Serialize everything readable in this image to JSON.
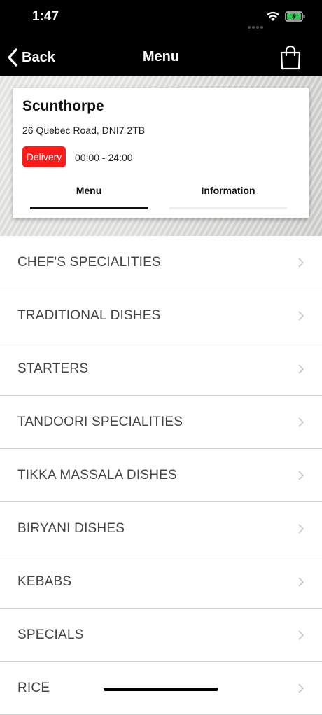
{
  "status_bar": {
    "time": "1:47"
  },
  "nav": {
    "back_label": "Back",
    "title": "Menu"
  },
  "store": {
    "name": "Scunthorpe",
    "address": "26 Quebec Road, DNI7 2TB",
    "delivery_badge": "Delivery",
    "hours": "00:00 - 24:00",
    "badge_color": "#ff1a1a"
  },
  "tabs": [
    {
      "label": "Menu",
      "active": true
    },
    {
      "label": "Information",
      "active": false
    }
  ],
  "menu": [
    {
      "label": "CHEF'S SPECIALITIES"
    },
    {
      "label": "TRADITIONAL DISHES"
    },
    {
      "label": "STARTERS"
    },
    {
      "label": "TANDOORI SPECIALITIES"
    },
    {
      "label": "TIKKA MASSALA DISHES"
    },
    {
      "label": "BIRYANI DISHES"
    },
    {
      "label": "KEBABS"
    },
    {
      "label": "SPECIALS"
    },
    {
      "label": "RICE"
    }
  ],
  "icons": {
    "back": "chevron-left-icon",
    "cart": "shopping-bag-icon",
    "row": "chevron-right-icon"
  }
}
